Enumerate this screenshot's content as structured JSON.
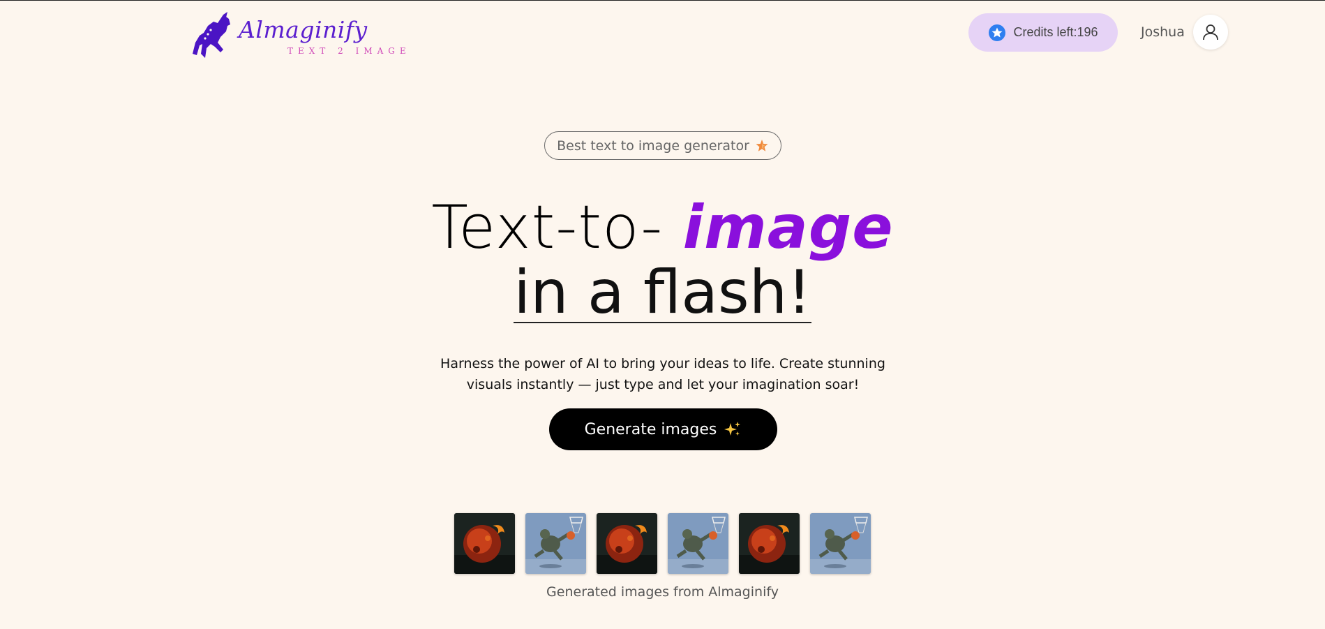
{
  "header": {
    "logo_name": "Almaginify",
    "logo_tagline": "TEXT 2 IMAGE",
    "credits_label": "Credits left:196",
    "username": "Joshua"
  },
  "hero": {
    "badge_text": "Best text to image generator",
    "headline_part1": "Text-to- ",
    "headline_accent": "image",
    "headline_line2": "in a flash!",
    "description": "Harness the power of AI to bring your ideas to life. Create stunning visuals instantly — just type and let your imagination soar!",
    "cta_label": "Generate images"
  },
  "gallery": {
    "images": [
      {
        "icon": "flaming-planet-image"
      },
      {
        "icon": "dunking-creature-image"
      },
      {
        "icon": "flaming-planet-image"
      },
      {
        "icon": "dunking-creature-image"
      },
      {
        "icon": "flaming-planet-image"
      },
      {
        "icon": "dunking-creature-image"
      }
    ],
    "caption": "Generated images from Almaginify"
  },
  "colors": {
    "background": "#fdf6ee",
    "accent_purple": "#8a10dc",
    "logo_purple": "#5b1fcf",
    "credits_bg": "#e6d3f6",
    "cta_bg": "#000000"
  }
}
